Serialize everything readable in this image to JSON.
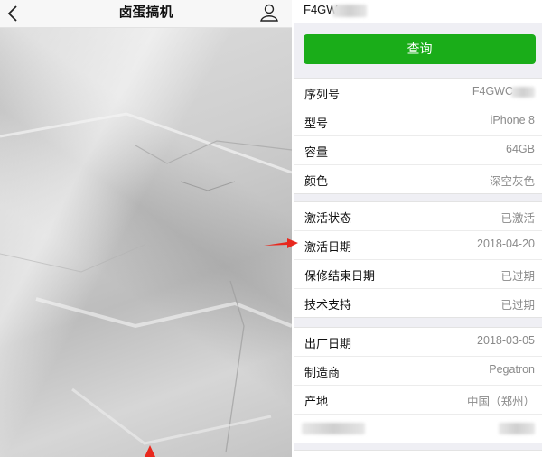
{
  "left": {
    "title": "卤蛋搞机",
    "icons": {
      "back": "back-chevron-icon",
      "user": "user-icon"
    }
  },
  "right": {
    "serial_prefix": "F4GW",
    "query_label": "查询",
    "groups": [
      {
        "rows": [
          {
            "label": "序列号",
            "value": "F4GWC"
          },
          {
            "label": "型号",
            "value": "iPhone 8"
          },
          {
            "label": "容量",
            "value": "64GB"
          },
          {
            "label": "颜色",
            "value": "深空灰色"
          }
        ]
      },
      {
        "rows": [
          {
            "label": "激活状态",
            "value": "已激活"
          },
          {
            "label": "激活日期",
            "value": "2018-04-20"
          },
          {
            "label": "保修结束日期",
            "value": "已过期"
          },
          {
            "label": "技术支持",
            "value": "已过期"
          }
        ]
      },
      {
        "rows": [
          {
            "label": "出厂日期",
            "value": "2018-03-05"
          },
          {
            "label": "制造商",
            "value": "Pegatron"
          },
          {
            "label": "产地",
            "value": "中国（郑州）"
          }
        ]
      }
    ]
  },
  "colors": {
    "accent_green": "#1aad19",
    "arrow_red": "#e8281e"
  }
}
